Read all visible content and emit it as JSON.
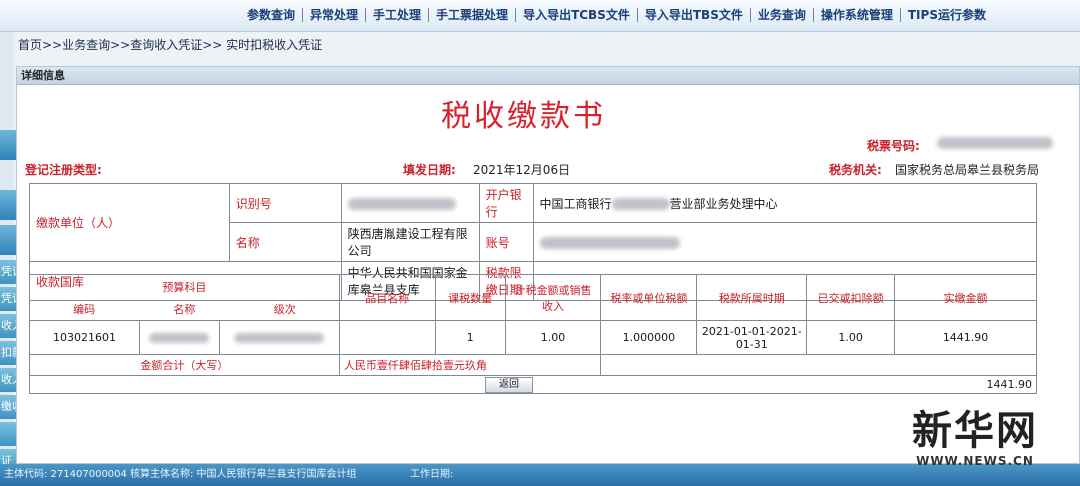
{
  "topnav": {
    "items": [
      "参数查询",
      "异常处理",
      "手工处理",
      "手工票据处理",
      "导入导出TCBS文件",
      "导入导出TBS文件",
      "业务查询",
      "操作系统管理",
      "TIPS运行参数"
    ]
  },
  "breadcrumb": "首页>>业务查询>>查询收入凭证>> 实时扣税收入凭证",
  "sidebar": {
    "items": [
      "凭证",
      "凭证",
      "收入凭",
      "扣款",
      "收入凭",
      "缴收入",
      "",
      "证"
    ]
  },
  "panel": {
    "header": "详细信息",
    "doc_title": "税收缴款书",
    "ticket_no_label": "税票号码:",
    "reg_type_label": "登记注册类型:",
    "fill_date_label": "填发日期:",
    "fill_date_value": "2021年12月06日",
    "tax_office_label": "税务机关:",
    "tax_office_value": "国家税务总局皋兰县税务局"
  },
  "form": {
    "payer_label": "缴款单位（人）",
    "id_label": "识别号",
    "name_label": "名称",
    "name_value": "陕西唐胤建设工程有限公司",
    "bank_label": "开户银行",
    "bank_prefix": "中国工商银行",
    "bank_suffix": "营业部业务处理中心",
    "account_label": "账号",
    "treasury_label": "收款国库",
    "treasury_value": "中华人民共和国国家金库皋兰县支库",
    "tax_deduct_date_label": "税款限缴日期"
  },
  "detail": {
    "budget_label": "预算科目",
    "col_code": "编码",
    "col_name": "名称",
    "col_level": "级次",
    "col_item": "品目名称",
    "col_qty": "课税数量",
    "col_taxable": "计税金额或销售收入",
    "col_rate": "税率或单位税额",
    "col_period": "税款所属时期",
    "col_paid": "已交或扣除额",
    "col_actual": "实缴金额",
    "row": {
      "code": "103021601",
      "qty": "1",
      "taxable": "1.00",
      "rate": "1.000000",
      "period": "2021-01-01-2021-01-31",
      "paid": "1.00",
      "actual": "1441.90"
    },
    "total_label": "金额合计（大写）",
    "total_words": "人民币壹仟肆佰肆拾壹元玖角",
    "total_amount": "1441.90"
  },
  "buttons": {
    "back": "返回"
  },
  "statusbar": {
    "code_label": "主体代码: 271407000004",
    "account_label": "核算主体名称: 中国人民银行皋兰县支行国库会计组",
    "work_label": "工作日期:"
  },
  "watermark": {
    "logo": "新华网",
    "url": "WWW.NEWS.CN"
  }
}
